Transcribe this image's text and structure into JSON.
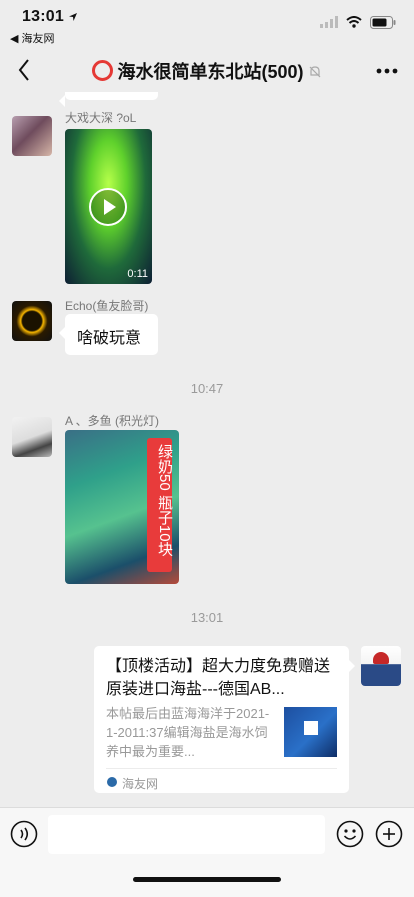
{
  "status_bar": {
    "time": "13:01",
    "back_app": "◀ 海友网"
  },
  "nav": {
    "title": "海水很简单东北站(500)"
  },
  "messages": [
    {
      "sender": "大戏大深 ?oL",
      "type": "video",
      "duration": "0:11"
    },
    {
      "sender": "Echo(鱼友脸哥)",
      "type": "text",
      "text": "啥破玩意"
    },
    {
      "sender": "A    、多鱼 (积光灯)",
      "type": "image",
      "overlay_text": "绿奶50 瓶子10块"
    }
  ],
  "timestamps": [
    "10:47",
    "13:01"
  ],
  "link_card": {
    "title": "【顶楼活动】超大力度免费赠送原装进口海盐---德国AB...",
    "description": "本帖最后由蓝海海洋于2021-1-2011:37编辑海盐是海水饲养中最为重要...",
    "source": "海友网"
  },
  "colors": {
    "background": "#ededed",
    "bubble": "#ffffff",
    "title_ring": "#e53935"
  }
}
